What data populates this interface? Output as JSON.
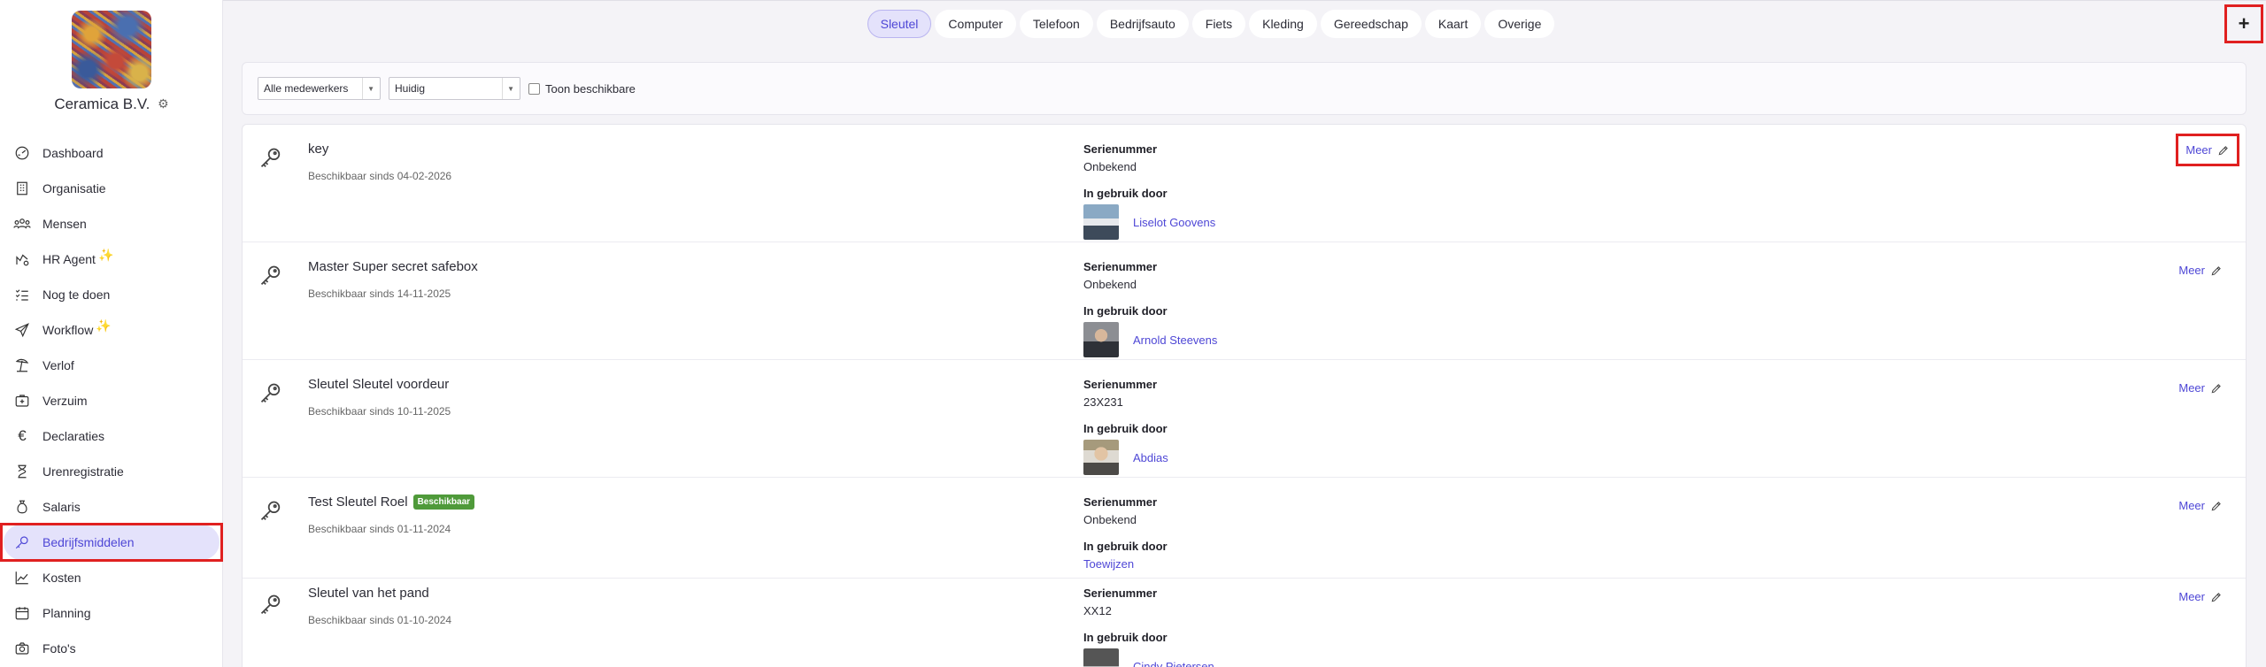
{
  "company": {
    "name": "Ceramica B.V."
  },
  "sidebar": {
    "items": [
      {
        "label": "Dashboard",
        "icon": "dashboard-icon"
      },
      {
        "label": "Organisatie",
        "icon": "building-icon"
      },
      {
        "label": "Mensen",
        "icon": "people-icon"
      },
      {
        "label": "HR Agent",
        "icon": "hr-agent-icon",
        "sparkle": true
      },
      {
        "label": "Nog te doen",
        "icon": "checklist-icon"
      },
      {
        "label": "Workflow",
        "icon": "send-icon",
        "sparkle": true
      },
      {
        "label": "Verlof",
        "icon": "beach-icon"
      },
      {
        "label": "Verzuim",
        "icon": "medical-icon"
      },
      {
        "label": "Declaraties",
        "icon": "euro-icon"
      },
      {
        "label": "Urenregistratie",
        "icon": "hourglass-icon"
      },
      {
        "label": "Salaris",
        "icon": "money-bag-icon"
      },
      {
        "label": "Bedrijfsmiddelen",
        "icon": "key-icon",
        "active": true
      },
      {
        "label": "Kosten",
        "icon": "chart-icon"
      },
      {
        "label": "Planning",
        "icon": "calendar-icon"
      },
      {
        "label": "Foto's",
        "icon": "camera-icon"
      }
    ]
  },
  "tabs": [
    "Sleutel",
    "Computer",
    "Telefoon",
    "Bedrijfsauto",
    "Fiets",
    "Kleding",
    "Gereedschap",
    "Kaart",
    "Overige"
  ],
  "active_tab": "Sleutel",
  "add_button": "+",
  "filters": {
    "employees": "Alle medewerkers",
    "period": "Huidig",
    "show_available": "Toon beschikbare"
  },
  "labels": {
    "serial": "Serienummer",
    "in_use_by": "In gebruik door",
    "more": "Meer"
  },
  "items": [
    {
      "name": "key",
      "since": "Beschikbaar sinds 04-02-2026",
      "serial": "Onbekend",
      "user": "Liselot Goovens"
    },
    {
      "name": "Master Super secret safebox",
      "since": "Beschikbaar sinds 14-11-2025",
      "serial": "Onbekend",
      "user": "Arnold Steevens"
    },
    {
      "name": "Sleutel Sleutel voordeur",
      "since": "Beschikbaar sinds 10-11-2025",
      "serial": "23X231",
      "user": "Abdias"
    },
    {
      "name": "Test Sleutel Roel",
      "badge": "Beschikbaar",
      "since": "Beschikbaar sinds 01-11-2024",
      "serial": "Onbekend",
      "assign": "Toewijzen"
    },
    {
      "name": "Sleutel van het pand",
      "since": "Beschikbaar sinds 01-10-2024",
      "serial": "XX12",
      "user": "Cindy Pietersen"
    }
  ]
}
